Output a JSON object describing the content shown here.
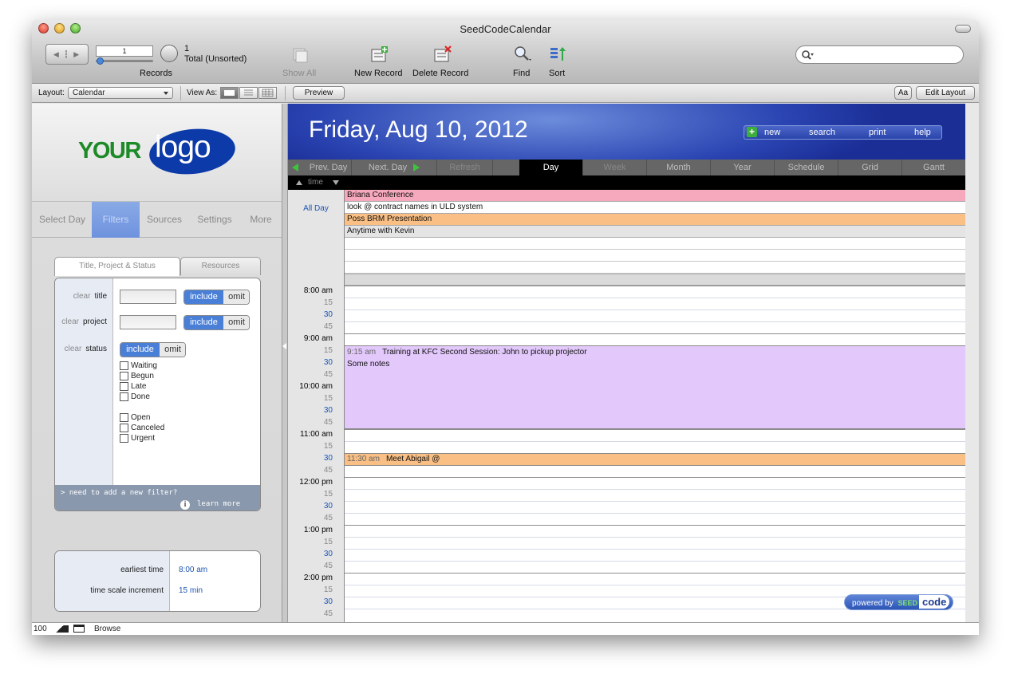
{
  "app": {
    "title": "SeedCodeCalendar"
  },
  "toolbar": {
    "record_value": "1",
    "records_label": "Records",
    "found_count": "1",
    "found_status": "Total (Unsorted)",
    "show_all": "Show All",
    "new_record": "New Record",
    "delete_record": "Delete Record",
    "find": "Find",
    "sort": "Sort",
    "search_placeholder": ""
  },
  "layoutbar": {
    "layout_label": "Layout:",
    "layout_value": "Calendar",
    "view_as_label": "View As:",
    "preview": "Preview",
    "aa": "Aa",
    "edit_layout": "Edit Layout"
  },
  "sidebar": {
    "logo_your": "YOUR",
    "logo_logo": "logo",
    "tabs": [
      {
        "label": "Select Day",
        "active": false
      },
      {
        "label": "Filters",
        "active": true
      },
      {
        "label": "Sources",
        "active": false
      },
      {
        "label": "Settings",
        "active": false
      },
      {
        "label": "More",
        "active": false
      }
    ],
    "filter_tabs": [
      "Title, Project & Status",
      "Resources"
    ],
    "clear": "clear",
    "include": "include",
    "omit": "omit",
    "filters": [
      {
        "label": "title"
      },
      {
        "label": "project"
      },
      {
        "label": "status"
      }
    ],
    "statuses_a": [
      "Waiting",
      "Begun",
      "Late",
      "Done"
    ],
    "statuses_b": [
      "Open",
      "Canceled",
      "Urgent"
    ],
    "footer_line1": "> need to add a new filter?",
    "footer_line2": "learn more",
    "info_icon": "i",
    "time_settings": {
      "earliest_label": "earliest time",
      "earliest_value": "8:00 am",
      "increment_label": "time scale increment",
      "increment_value": "15 min"
    }
  },
  "calendar": {
    "date_title": "Friday, Aug 10, 2012",
    "header_actions": [
      "new",
      "search",
      "print",
      "help"
    ],
    "nav": {
      "prev": "Prev. Day",
      "next": "Next. Day",
      "refresh": "Refresh"
    },
    "views": [
      {
        "label": "Day",
        "active": true
      },
      {
        "label": "Week",
        "active": false
      },
      {
        "label": "Month",
        "active": false
      },
      {
        "label": "Year",
        "active": false
      },
      {
        "label": "Schedule",
        "active": false
      },
      {
        "label": "Grid",
        "active": false
      },
      {
        "label": "Gantt",
        "active": false
      }
    ],
    "time_toggle": "time",
    "all_day_label": "All Day",
    "all_day_events": [
      {
        "title": "Briana Conference",
        "color": "#f6a8bc"
      },
      {
        "title": "look @ contract names in ULD system",
        "color": "#ffffff"
      },
      {
        "title": "Poss BRM Presentation",
        "color": "#f9bf84"
      },
      {
        "title": "Anytime with Kevin",
        "color": "#e4e4e4"
      }
    ],
    "time_labels": [
      "8:00 am",
      "15",
      "30",
      "45",
      "9:00 am",
      "15",
      "30",
      "45",
      "10:00 am",
      "15",
      "30",
      "45",
      "11:00 am",
      "15",
      "30",
      "45",
      "12:00 pm",
      "15",
      "30",
      "45",
      "1:00 pm",
      "15",
      "30",
      "45",
      "2:00 pm",
      "15",
      "30",
      "45"
    ],
    "events": [
      {
        "time": "9:15 am",
        "title": "Training at KFC Second Session: John to pickup projector",
        "notes": "Some notes",
        "color": "#e3c8fb"
      },
      {
        "time": "11:30 am",
        "title": "Meet Abigail @",
        "notes": "",
        "color": "#f9bf84"
      }
    ],
    "powered_by": "powered by",
    "seed": "SEED",
    "code": "code"
  },
  "statusbar": {
    "zoom": "100",
    "mode": "Browse"
  }
}
